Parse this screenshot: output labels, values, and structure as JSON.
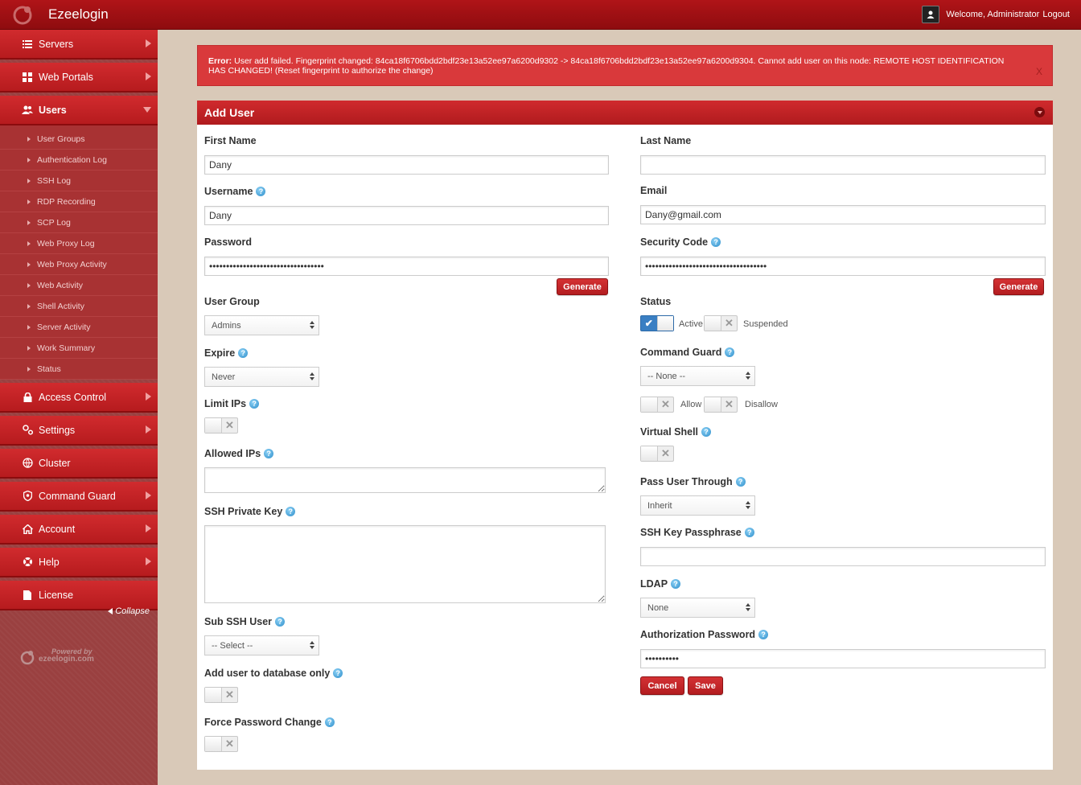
{
  "app": {
    "title": "Ezeelogin",
    "welcome": "Welcome, Administrator",
    "logout": "Logout"
  },
  "sidebar": {
    "items": [
      {
        "label": "Servers",
        "icon": "list-icon"
      },
      {
        "label": "Web Portals",
        "icon": "grid-icon"
      },
      {
        "label": "Users",
        "icon": "users-icon"
      },
      {
        "label": "Access Control",
        "icon": "lock-icon"
      },
      {
        "label": "Settings",
        "icon": "gears-icon"
      },
      {
        "label": "Cluster",
        "icon": "globe-icon"
      },
      {
        "label": "Command Guard",
        "icon": "shield-icon"
      },
      {
        "label": "Account",
        "icon": "home-icon"
      },
      {
        "label": "Help",
        "icon": "lifebuoy-icon"
      },
      {
        "label": "License",
        "icon": "document-icon"
      }
    ],
    "users_sub": [
      "User Groups",
      "Authentication Log",
      "SSH Log",
      "RDP Recording",
      "SCP Log",
      "Web Proxy Log",
      "Web Proxy Activity",
      "Web Activity",
      "Shell Activity",
      "Server Activity",
      "Work Summary",
      "Status"
    ],
    "collapse": "Collapse",
    "powered_by": "Powered by",
    "powered_site": "ezeelogin.com"
  },
  "alert": {
    "prefix": "Error:",
    "message": "User add failed. Fingerprint changed: 84ca18f6706bdd2bdf23e13a52ee97a6200d9302 -> 84ca18f6706bdd2bdf23e13a52ee97a6200d9304. Cannot add user on this node: REMOTE HOST IDENTIFICATION HAS CHANGED! (Reset fingerprint to authorize the change)",
    "close": "X"
  },
  "panel": {
    "title": "Add User"
  },
  "form": {
    "first_name": {
      "label": "First Name",
      "value": "Dany"
    },
    "last_name": {
      "label": "Last Name",
      "value": ""
    },
    "username": {
      "label": "Username",
      "value": "Dany"
    },
    "email": {
      "label": "Email",
      "value": "Dany@gmail.com"
    },
    "password": {
      "label": "Password",
      "value": "abcdefghijklmnopqrstuvwxyz12345678"
    },
    "security_code": {
      "label": "Security Code",
      "value": "abcdefghijklmnopqrstuvwxyz1234567890"
    },
    "generate": "Generate",
    "user_group": {
      "label": "User Group",
      "value": "Admins"
    },
    "status": {
      "label": "Status",
      "active": "Active",
      "suspended": "Suspended"
    },
    "expire": {
      "label": "Expire",
      "value": "Never"
    },
    "command_guard": {
      "label": "Command Guard",
      "value": "-- None --",
      "allow": "Allow",
      "disallow": "Disallow"
    },
    "limit_ips": {
      "label": "Limit IPs"
    },
    "virtual_shell": {
      "label": "Virtual Shell"
    },
    "allowed_ips": {
      "label": "Allowed IPs"
    },
    "pass_user_through": {
      "label": "Pass User Through",
      "value": "Inherit"
    },
    "ssh_private_key": {
      "label": "SSH Private Key"
    },
    "ssh_key_passphrase": {
      "label": "SSH Key Passphrase"
    },
    "ldap": {
      "label": "LDAP",
      "value": "None"
    },
    "sub_ssh_user": {
      "label": "Sub SSH User",
      "value": "-- Select --"
    },
    "authorization_password": {
      "label": "Authorization Password",
      "value": "abcdefghij"
    },
    "add_db_only": {
      "label": "Add user to database only"
    },
    "force_password_change": {
      "label": "Force Password Change"
    },
    "cancel": "Cancel",
    "save": "Save"
  }
}
